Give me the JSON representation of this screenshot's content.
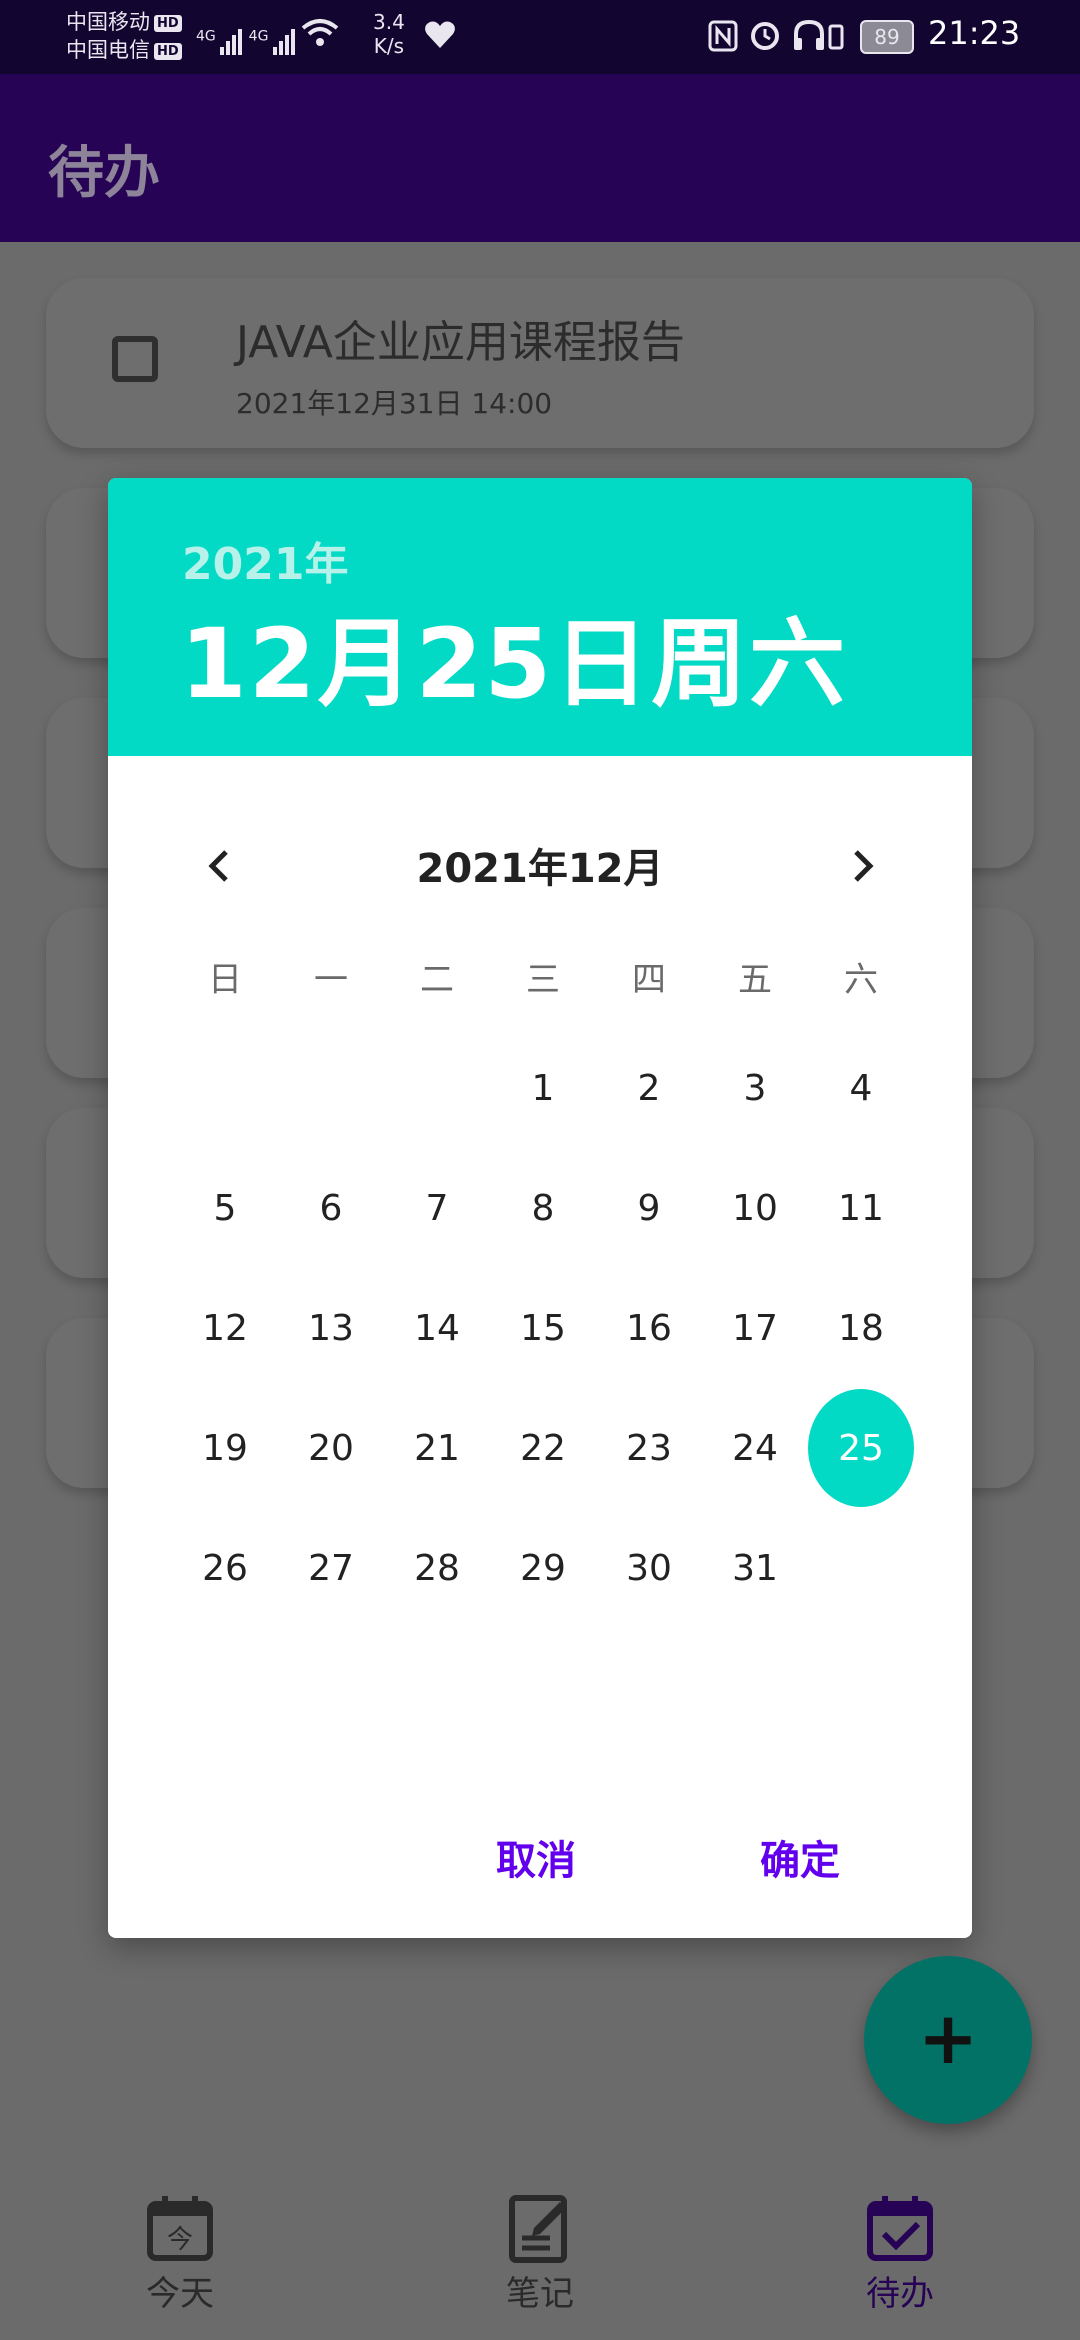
{
  "status_bar": {
    "carrier1": "中国移动",
    "carrier2": "中国电信",
    "hd_badge": "HD",
    "net1": "4G",
    "net2": "4G",
    "speed_value": "3.4",
    "speed_unit": "K/s",
    "battery": "89",
    "time": "21:23"
  },
  "app_bar": {
    "title": "待办"
  },
  "todo_list": [
    {
      "title": "JAVA企业应用课程报告",
      "due": "2021年12月31日 14:00"
    }
  ],
  "date_picker": {
    "header_year": "2021年",
    "header_date": "12月25日周六",
    "month_label": "2021年12月",
    "weekdays": [
      "日",
      "一",
      "二",
      "三",
      "四",
      "五",
      "六"
    ],
    "weeks": [
      [
        "",
        "",
        "",
        "1",
        "2",
        "3",
        "4"
      ],
      [
        "5",
        "6",
        "7",
        "8",
        "9",
        "10",
        "11"
      ],
      [
        "12",
        "13",
        "14",
        "15",
        "16",
        "17",
        "18"
      ],
      [
        "19",
        "20",
        "21",
        "22",
        "23",
        "24",
        "25"
      ],
      [
        "26",
        "27",
        "28",
        "29",
        "30",
        "31",
        ""
      ]
    ],
    "selected_day": "25",
    "cancel_label": "取消",
    "confirm_label": "确定",
    "accent_color": "#03dac5",
    "button_color": "#6200ee"
  },
  "fab": {
    "icon": "plus-icon",
    "glyph": "+"
  },
  "bottom_nav": [
    {
      "label": "今天",
      "icon": "calendar-today-icon",
      "active": false
    },
    {
      "label": "笔记",
      "icon": "note-edit-icon",
      "active": false
    },
    {
      "label": "待办",
      "icon": "calendar-check-icon",
      "active": true
    }
  ]
}
